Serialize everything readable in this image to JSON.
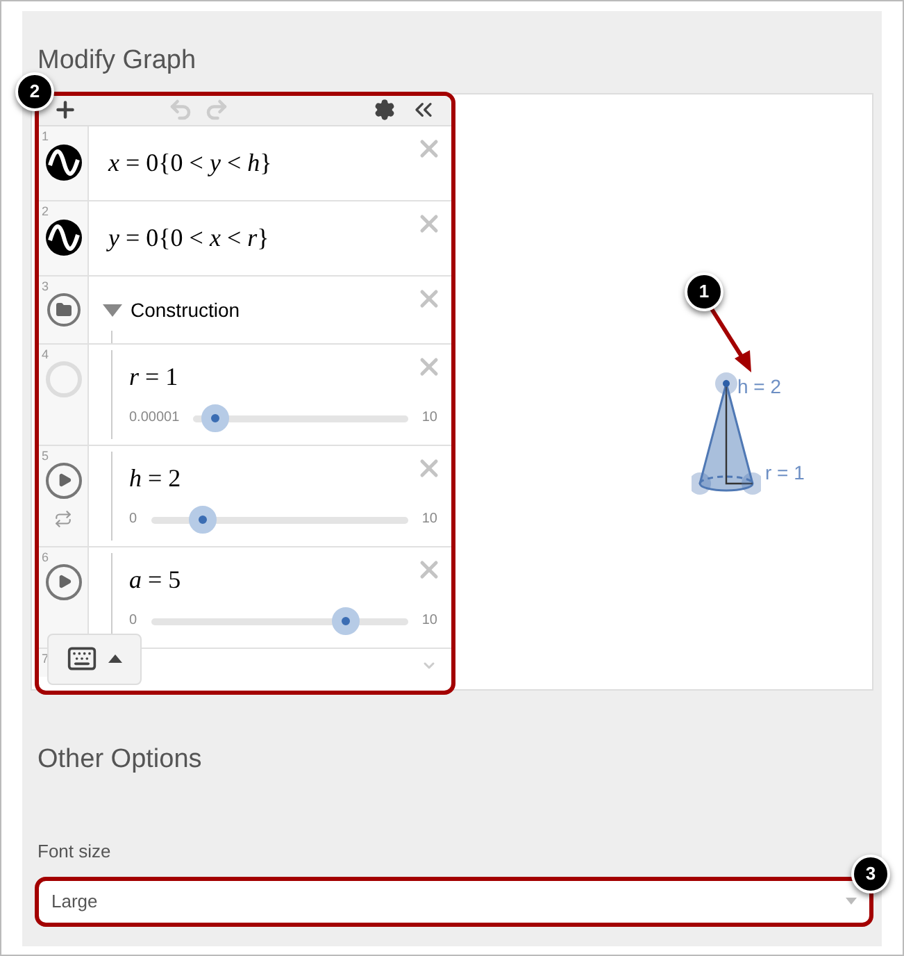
{
  "sections": {
    "graph_title": "Modify Graph",
    "other_title": "Other Options"
  },
  "expressions": [
    {
      "kind": "expression",
      "number": "1",
      "latex": "*x* = 0{0 < *y* < *h*}"
    },
    {
      "kind": "expression",
      "number": "2",
      "latex": "*y* = 0{0 < *x* < *r*}"
    },
    {
      "kind": "folder",
      "number": "3",
      "label": "Construction",
      "expanded": true
    },
    {
      "kind": "slider",
      "number": "4",
      "latex": "*r* = 1",
      "min": "0.00001",
      "max": "10",
      "level": 0.1,
      "playable": false,
      "repeat": false
    },
    {
      "kind": "slider",
      "number": "5",
      "latex": "*h* = 2",
      "min": "0",
      "max": "10",
      "level": 0.2,
      "playable": true,
      "repeat": true
    },
    {
      "kind": "slider",
      "number": "6",
      "latex": "*a* = 5",
      "min": "0",
      "max": "10",
      "level": 0.76,
      "playable": true,
      "repeat": false
    },
    {
      "kind": "partial",
      "number": "7"
    }
  ],
  "graph": {
    "labels": [
      "h = 2",
      "r = 1"
    ]
  },
  "font_size": {
    "label": "Font size",
    "value": "Large"
  },
  "callouts": [
    "1",
    "2",
    "3"
  ]
}
